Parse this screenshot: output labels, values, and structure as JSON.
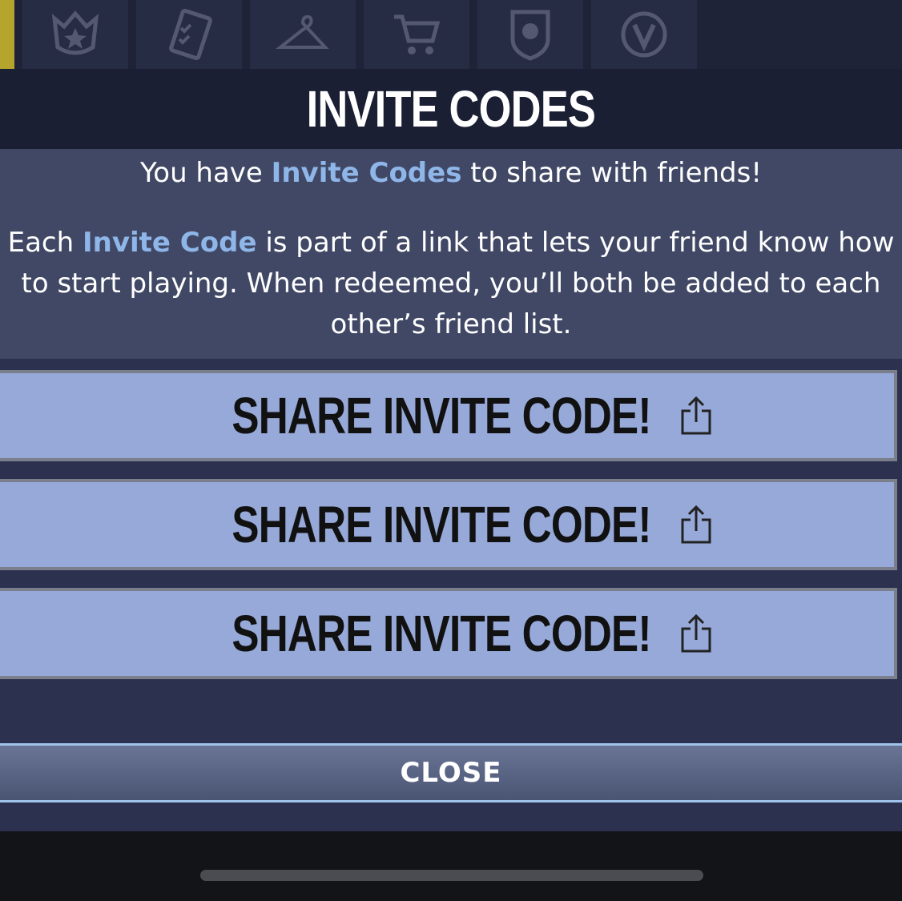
{
  "nav": {
    "tabs": [
      {
        "icon": "star-crest-icon"
      },
      {
        "icon": "challenges-icon"
      },
      {
        "icon": "hanger-icon"
      },
      {
        "icon": "cart-icon"
      },
      {
        "icon": "career-shield-icon"
      },
      {
        "icon": "vbucks-icon"
      }
    ],
    "accent_color": "#b6a52c"
  },
  "modal": {
    "title": "INVITE CODES",
    "intro": {
      "before": "You have ",
      "highlight": "Invite Codes",
      "after": " to share with friends!"
    },
    "description": {
      "before": "Each ",
      "highlight": "Invite Code",
      "after": " is part of a link that lets your friend know how to start playing. When redeemed, you’ll both be added to each other’s friend list."
    },
    "share_buttons": [
      {
        "label": "SHARE INVITE CODE!",
        "icon": "share-icon"
      },
      {
        "label": "SHARE INVITE CODE!",
        "icon": "share-icon"
      },
      {
        "label": "SHARE INVITE CODE!",
        "icon": "share-icon"
      }
    ],
    "close_label": "CLOSE",
    "highlight_color": "#8fb6e8",
    "button_color": "#96a9d8"
  }
}
